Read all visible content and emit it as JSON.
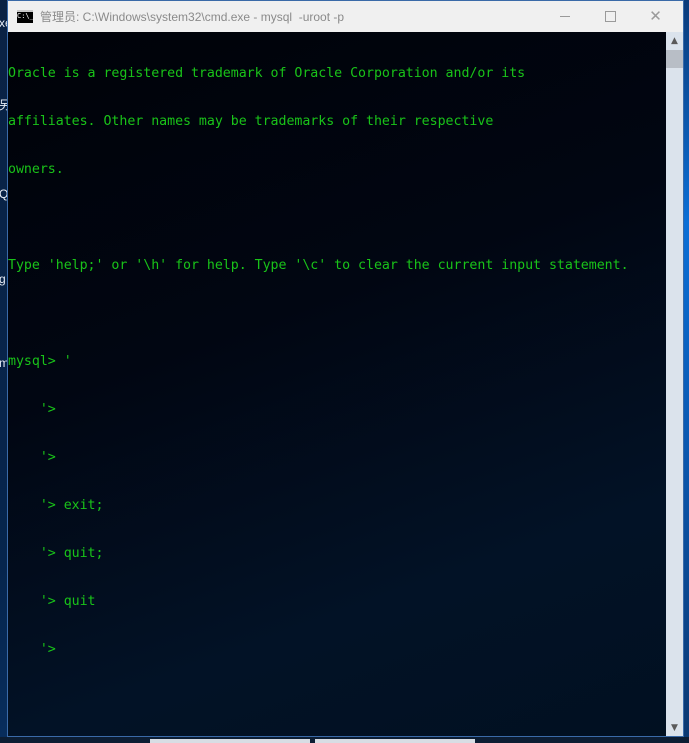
{
  "window": {
    "title": "管理员: C:\\Windows\\system32\\cmd.exe - mysql  -uroot -p",
    "icon_label": "C:\\_",
    "controls": {
      "minimize": "minimize",
      "maximize": "maximize",
      "close": "✕"
    }
  },
  "desktop": {
    "edge_labels": [
      "xe",
      "另",
      "Q",
      "g",
      "m"
    ]
  },
  "console": {
    "text_color": "#19c319",
    "lines": [
      "Oracle is a registered trademark of Oracle Corporation and/or its",
      "affiliates. Other names may be trademarks of their respective",
      "owners.",
      "",
      "Type 'help;' or '\\h' for help. Type '\\c' to clear the current input statement.",
      "",
      "mysql> '",
      "    '>",
      "    '>",
      "    '> exit;",
      "    '> quit;",
      "    '> quit",
      "    '>"
    ]
  },
  "scrollbar": {
    "up_arrow": "▲",
    "down_arrow": "▼"
  }
}
